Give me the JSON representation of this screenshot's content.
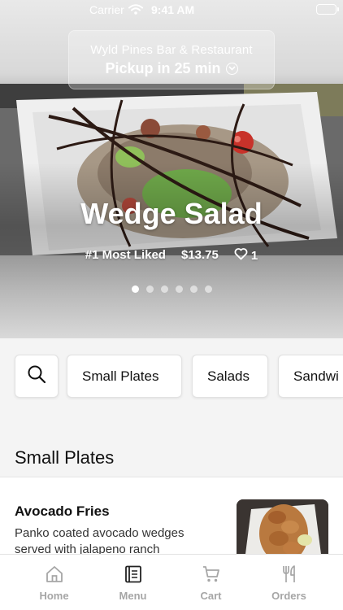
{
  "status_bar": {
    "carrier": "Carrier",
    "time": "9:41 AM"
  },
  "header": {
    "restaurant_name": "Wyld Pines Bar & Restaurant",
    "pickup_text": "Pickup in 25 min"
  },
  "featured": {
    "title": "Wedge Salad",
    "badge": "#1 Most Liked",
    "price": "$13.75",
    "likes": "1",
    "carousel_total": 6,
    "carousel_active": 1
  },
  "categories": {
    "search_icon": "search-icon",
    "items": [
      "Small Plates",
      "Salads",
      "Sandwi"
    ]
  },
  "section": {
    "title": "Small Plates",
    "item": {
      "name": "Avocado Fries",
      "description_line1": "Panko coated avocado wedges",
      "description_line2": "served with jalapeno ranch"
    }
  },
  "tabbar": {
    "tabs": [
      {
        "label": "Home",
        "icon": "home-icon",
        "active": false
      },
      {
        "label": "Menu",
        "icon": "menu-book-icon",
        "active": true
      },
      {
        "label": "Cart",
        "icon": "cart-icon",
        "active": false
      },
      {
        "label": "Orders",
        "icon": "utensils-icon",
        "active": false
      }
    ]
  },
  "colors": {
    "active_tab": "#222222",
    "inactive_tab": "#a6a6a6",
    "background": "#f4f4f4"
  }
}
